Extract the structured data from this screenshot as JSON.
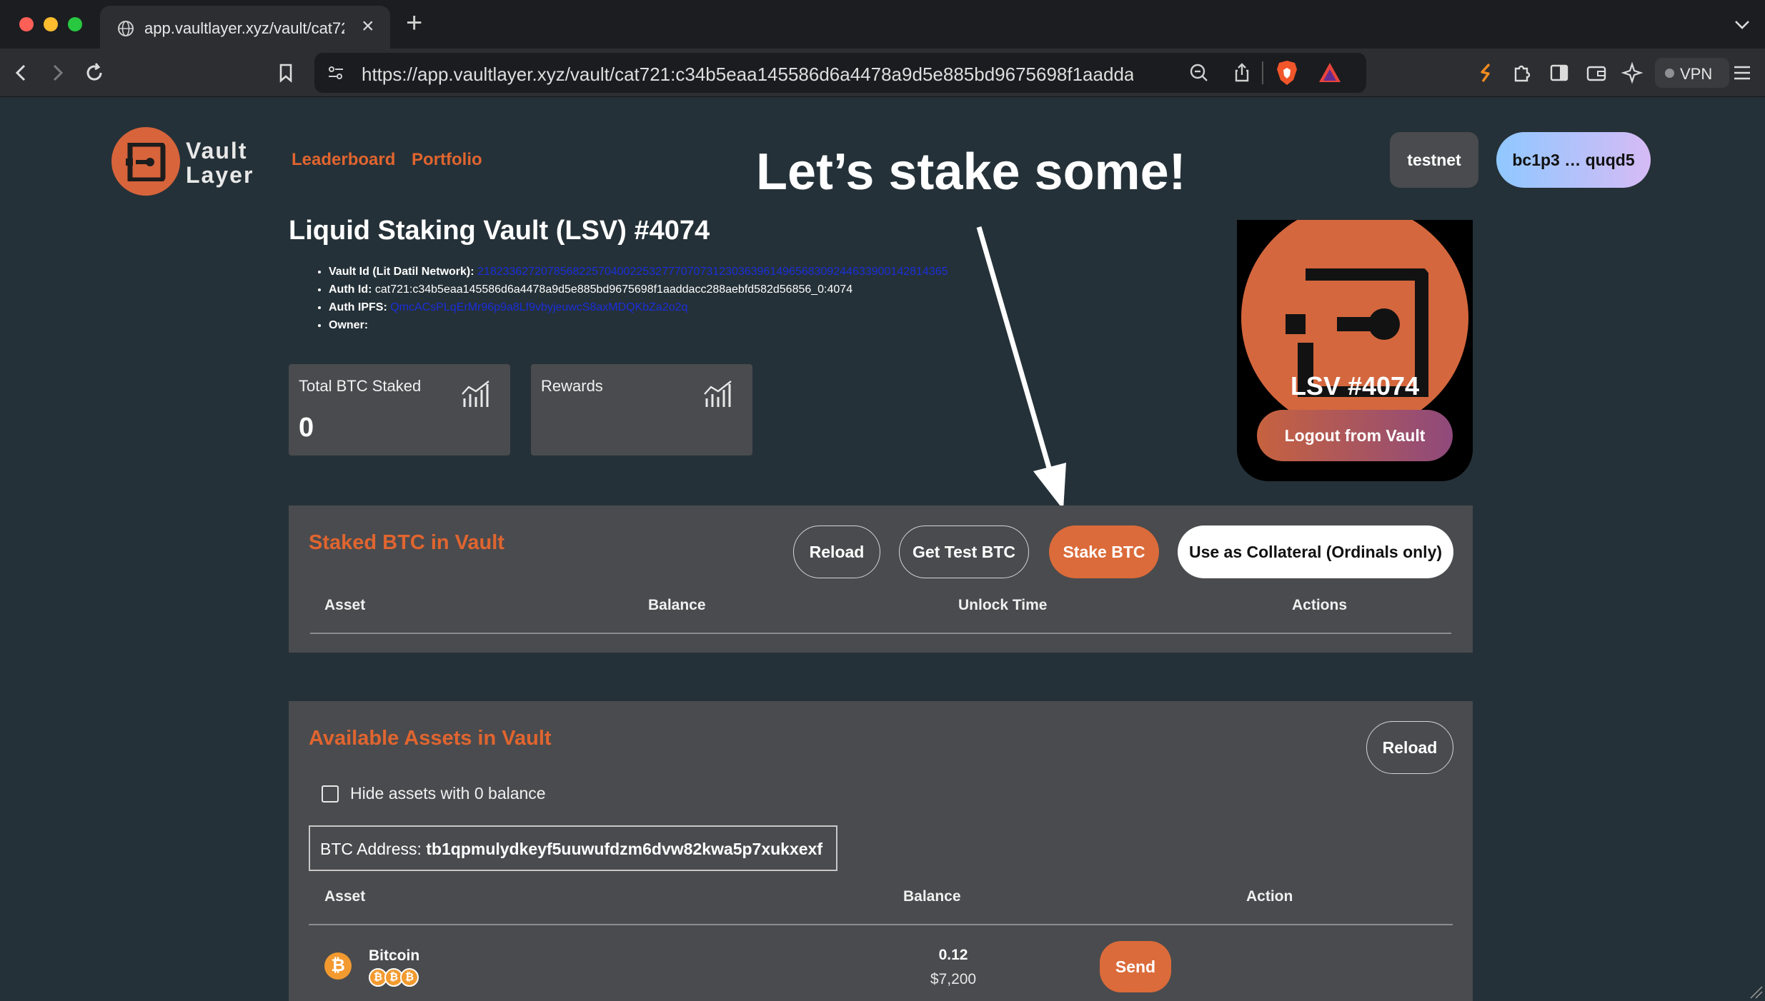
{
  "browser": {
    "tab_title": "app.vaultlayer.xyz/vault/cat721",
    "url": "https://app.vaultlayer.xyz/vault/cat721:c34b5eaa145586d6a4478a9d5e885bd9675698f1aaddacc...",
    "vpn_label": "VPN"
  },
  "header": {
    "logo_line1": "Vault",
    "logo_line2": "Layer",
    "nav": [
      "Leaderboard",
      "Portfolio"
    ],
    "network_button": "testnet",
    "wallet_button": "bc1p3 … quqd5"
  },
  "annotation": "Let’s stake some!",
  "vault": {
    "title": "Liquid Staking Vault (LSV) #4074",
    "info": {
      "vault_id_label": "Vault Id (Lit Datil Network):",
      "vault_id_value": "21823362720785682257040022532777070731230363961496568309244633900142814365",
      "auth_id_label": "Auth Id:",
      "auth_id_value": "cat721:c34b5eaa145586d6a4478a9d5e885bd9675698f1aaddacc288aebfd582d56856_0:4074",
      "auth_ipfs_label": "Auth IPFS:",
      "auth_ipfs_value": "QmcACsPLqErMr96p9a8Lf9vbyjeuwcS8axMDQKbZa2o2q",
      "owner_label": "Owner:",
      "owner_value": ""
    },
    "stats": [
      {
        "label": "Total BTC Staked",
        "value": "0"
      },
      {
        "label": "Rewards",
        "value": ""
      }
    ],
    "nft_label": "LSV #4074",
    "logout_button": "Logout from Vault"
  },
  "staked_panel": {
    "title": "Staked BTC in Vault",
    "buttons": {
      "reload": "Reload",
      "get_test_btc": "Get Test BTC",
      "stake_btc": "Stake BTC",
      "collateral": "Use as Collateral (Ordinals only)"
    },
    "columns": [
      "Asset",
      "Balance",
      "Unlock Time",
      "Actions"
    ]
  },
  "assets_panel": {
    "title": "Available Assets in Vault",
    "reload_button": "Reload",
    "hide_zero_label": "Hide assets with 0 balance",
    "hide_zero_checked": false,
    "btc_address_label": "BTC Address: ",
    "btc_address_value": "tb1qpmulydkeyf5uuwufdzm6dvw82kwa5p7xukxexf",
    "columns": [
      "Asset",
      "Balance",
      "Action"
    ],
    "rows": [
      {
        "name": "Bitcoin",
        "balance": "0.12",
        "usd": "$7,200",
        "action": "Send",
        "icon": "bitcoin-icon"
      }
    ]
  },
  "colors": {
    "accent": "#e0652f",
    "background": "#253138",
    "panel": "#4a4b4e"
  }
}
